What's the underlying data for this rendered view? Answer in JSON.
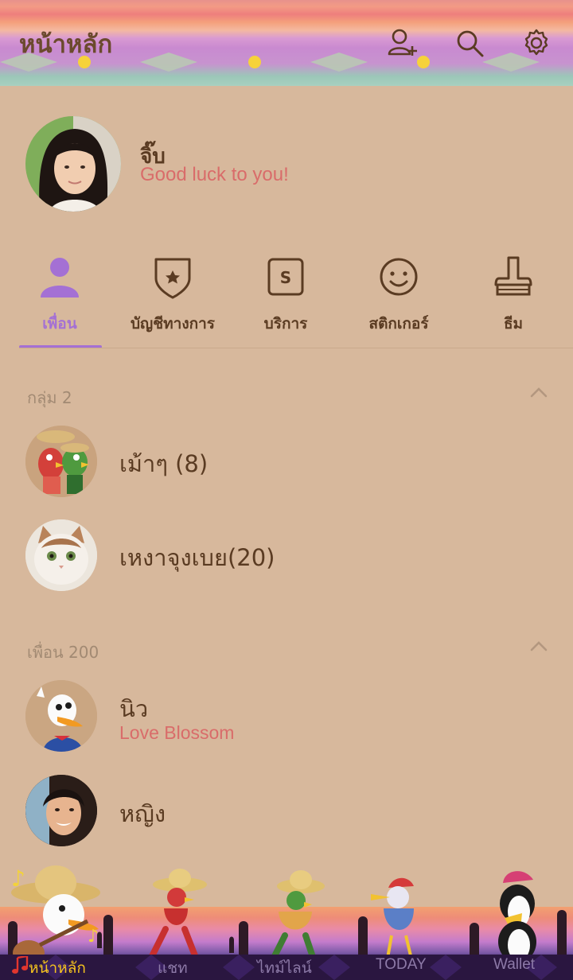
{
  "header": {
    "title": "หน้าหลัก"
  },
  "profile": {
    "name": "จิ๊บ",
    "status": "Good luck to you!"
  },
  "tabs": [
    {
      "label": "เพื่อน",
      "icon": "person-icon",
      "active": true
    },
    {
      "label": "บัญชีทางการ",
      "icon": "shield-star-icon"
    },
    {
      "label": "บริการ",
      "icon": "s-box-icon"
    },
    {
      "label": "สติกเกอร์",
      "icon": "smiley-icon"
    },
    {
      "label": "ธีม",
      "icon": "brush-icon"
    }
  ],
  "groups": {
    "title": "กลุ่ม 2",
    "items": [
      {
        "name": "เม้าๆ (8)"
      },
      {
        "name": "เหงาจุงเบย(20)"
      }
    ]
  },
  "friends": {
    "title": "เพื่อน 200",
    "items": [
      {
        "name": "นิว",
        "status": "Love Blossom"
      },
      {
        "name": "หญิง"
      }
    ]
  },
  "bottom_nav": [
    {
      "label": "หน้าหลัก",
      "active": true
    },
    {
      "label": "แชท"
    },
    {
      "label": "ไทม์ไลน์"
    },
    {
      "label": "TODAY"
    },
    {
      "label": "Wallet"
    }
  ],
  "colors": {
    "accent": "#a470d4",
    "background": "#d7b89c",
    "status_text": "#d96c6a",
    "active_nav": "#f6c41e"
  }
}
